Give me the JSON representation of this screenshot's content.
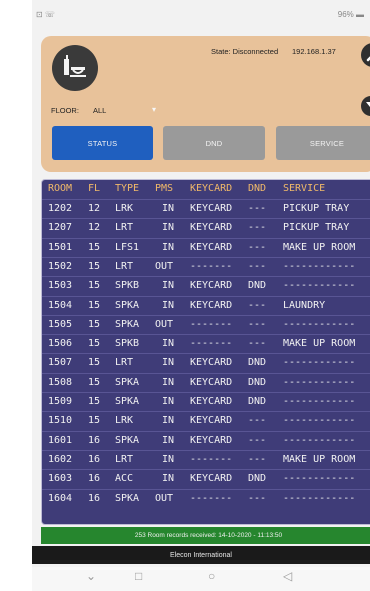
{
  "status_bar": {
    "left": "⊡ ☏",
    "right": "96% ▬"
  },
  "header": {
    "state_text": "State: Disconnected",
    "ip": "192.168.1.37",
    "floor_label": "FLOOR:",
    "floor_value": "ALL",
    "floor_caret": "▾"
  },
  "buttons": {
    "status": "STATUS",
    "dnd": "DND",
    "service": "SERVICE"
  },
  "table": {
    "headers": [
      "ROOM",
      "FL",
      "TYPE",
      "PMS",
      "KEYCARD",
      "DND",
      "SERVICE"
    ],
    "rows": [
      {
        "room": "1202",
        "fl": "12",
        "type": "LRK",
        "pms": "IN",
        "keycard": "KEYCARD",
        "dnd": "---",
        "service": "PICKUP TRAY"
      },
      {
        "room": "1207",
        "fl": "12",
        "type": "LRT",
        "pms": "IN",
        "keycard": "KEYCARD",
        "dnd": "---",
        "service": "PICKUP TRAY"
      },
      {
        "room": "1501",
        "fl": "15",
        "type": "LFS1",
        "pms": "IN",
        "keycard": "KEYCARD",
        "dnd": "---",
        "service": "MAKE UP ROOM"
      },
      {
        "room": "1502",
        "fl": "15",
        "type": "LRT",
        "pms": "OUT",
        "keycard": "-------",
        "dnd": "---",
        "service": "------------"
      },
      {
        "room": "1503",
        "fl": "15",
        "type": "SPKB",
        "pms": "IN",
        "keycard": "KEYCARD",
        "dnd": "DND",
        "service": "------------"
      },
      {
        "room": "1504",
        "fl": "15",
        "type": "SPKA",
        "pms": "IN",
        "keycard": "KEYCARD",
        "dnd": "---",
        "service": "LAUNDRY"
      },
      {
        "room": "1505",
        "fl": "15",
        "type": "SPKA",
        "pms": "OUT",
        "keycard": "-------",
        "dnd": "---",
        "service": "------------"
      },
      {
        "room": "1506",
        "fl": "15",
        "type": "SPKB",
        "pms": "IN",
        "keycard": "-------",
        "dnd": "---",
        "service": "MAKE UP ROOM"
      },
      {
        "room": "1507",
        "fl": "15",
        "type": "LRT",
        "pms": "IN",
        "keycard": "KEYCARD",
        "dnd": "DND",
        "service": "------------"
      },
      {
        "room": "1508",
        "fl": "15",
        "type": "SPKA",
        "pms": "IN",
        "keycard": "KEYCARD",
        "dnd": "DND",
        "service": "------------"
      },
      {
        "room": "1509",
        "fl": "15",
        "type": "SPKA",
        "pms": "IN",
        "keycard": "KEYCARD",
        "dnd": "DND",
        "service": "------------"
      },
      {
        "room": "1510",
        "fl": "15",
        "type": "LRK",
        "pms": "IN",
        "keycard": "KEYCARD",
        "dnd": "---",
        "service": "------------"
      },
      {
        "room": "1601",
        "fl": "16",
        "type": "SPKA",
        "pms": "IN",
        "keycard": "KEYCARD",
        "dnd": "---",
        "service": "------------"
      },
      {
        "room": "1602",
        "fl": "16",
        "type": "LRT",
        "pms": "IN",
        "keycard": "-------",
        "dnd": "---",
        "service": "MAKE UP ROOM"
      },
      {
        "room": "1603",
        "fl": "16",
        "type": "ACC",
        "pms": "IN",
        "keycard": "KEYCARD",
        "dnd": "DND",
        "service": "------------"
      },
      {
        "room": "1604",
        "fl": "16",
        "type": "SPKA",
        "pms": "OUT",
        "keycard": "-------",
        "dnd": "---",
        "service": "------------"
      }
    ]
  },
  "footer": {
    "records_text": "253 Room records received: 14-10-2020 - 11:13:50",
    "company": "Elecon International"
  },
  "nav_bar": {
    "down": "⌄",
    "square": "□",
    "circle": "○",
    "back": "◁"
  },
  "colors": {
    "accent_blue": "#1f5fbf",
    "panel": "#e8c29a",
    "table_bg": "#3f3c78",
    "header_text": "#f0b96a",
    "footer_green": "#26862e"
  }
}
